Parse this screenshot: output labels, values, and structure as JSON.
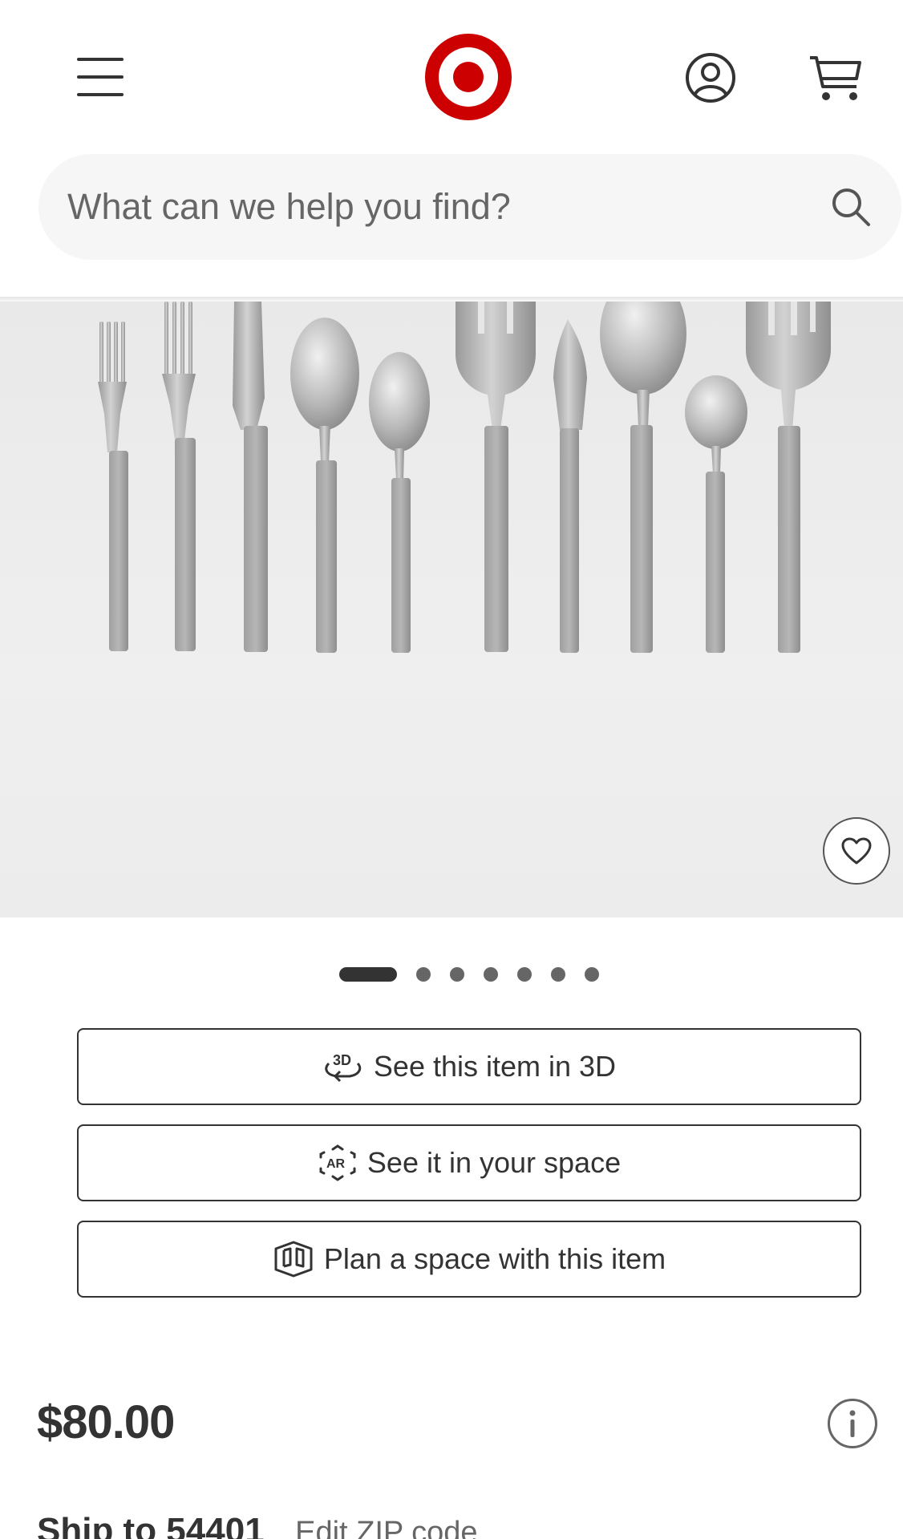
{
  "header": {
    "search_placeholder": "What can we help you find?"
  },
  "icons": {
    "menu": "hamburger-menu-icon",
    "logo": "target-bullseye-logo",
    "account": "account-icon",
    "cart": "cart-icon",
    "search": "search-icon",
    "favorite": "heart-icon",
    "info": "info-icon"
  },
  "colors": {
    "brand": "#cc0000",
    "text": "#333333",
    "muted": "#666666",
    "search_bg": "#f6f6f6",
    "gallery_bg": "#ececec"
  },
  "gallery": {
    "total_images": 7,
    "active_index": 0
  },
  "actions": [
    {
      "label": "See this item in 3D",
      "icon": "3d-rotate-icon"
    },
    {
      "label": "See it in your space",
      "icon": "ar-icon"
    },
    {
      "label": "Plan a space with this item",
      "icon": "room-planner-icon"
    }
  ],
  "product": {
    "price": "$80.00"
  },
  "shipping": {
    "label": "Ship to 54401",
    "edit_link": "Edit ZIP code"
  }
}
